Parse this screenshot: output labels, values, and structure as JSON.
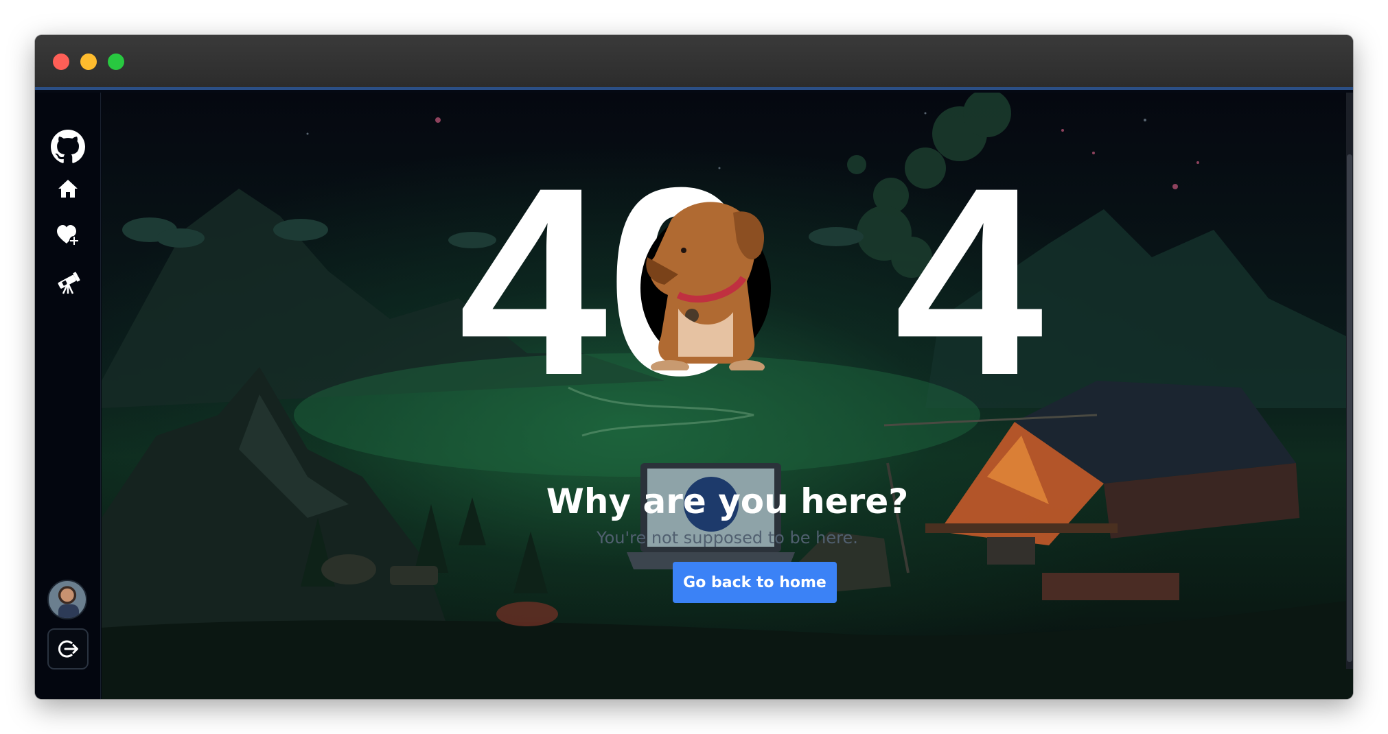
{
  "window": {
    "traffic_lights": {
      "close": "#fe5f57",
      "minimize": "#febc2e",
      "maximize": "#28c840"
    }
  },
  "sidebar": {
    "items": [
      {
        "icon": "github-icon"
      },
      {
        "icon": "home-icon"
      },
      {
        "icon": "heart-plus-icon"
      },
      {
        "icon": "telescope-icon"
      }
    ],
    "footer": [
      {
        "icon": "avatar"
      },
      {
        "icon": "logout-icon"
      }
    ]
  },
  "error": {
    "digit_left": "4",
    "digit_middle": "0",
    "digit_right": "4",
    "title": "Why are you here?",
    "subtitle": "You're not supposed to be here.",
    "button_label": "Go back to home"
  },
  "colors": {
    "accent": "#3b82f6",
    "background": "#050913",
    "text": "#ffffff",
    "muted_text": "#516070"
  }
}
